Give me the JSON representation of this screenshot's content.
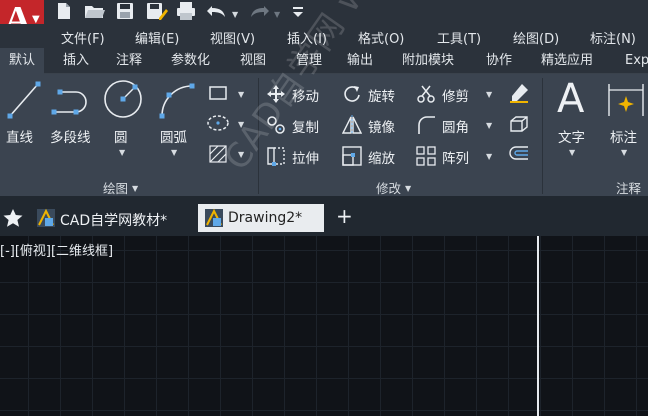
{
  "app": {
    "logo_letter": "A",
    "logo_color": "#c4262a"
  },
  "quick_access": {
    "icons": [
      "new-file-icon",
      "open-folder-icon",
      "save-icon",
      "save-as-icon",
      "print-icon",
      "undo-icon",
      "redo-icon",
      "customize-arrow-icon"
    ]
  },
  "menubar": {
    "items": [
      "文件(F)",
      "编辑(E)",
      "视图(V)",
      "插入(I)",
      "格式(O)",
      "工具(T)",
      "绘图(D)",
      "标注(N)"
    ]
  },
  "ribbon_tabs": {
    "active": "默认",
    "items": [
      "默认",
      "插入",
      "注释",
      "参数化",
      "视图",
      "管理",
      "输出",
      "附加模块",
      "协作",
      "精选应用",
      "Exp"
    ]
  },
  "draw_panel": {
    "title": "绘图",
    "tools": [
      "直线",
      "多段线",
      "圆",
      "圆弧"
    ]
  },
  "modify_panel": {
    "title": "修改",
    "tools": [
      "移动",
      "旋转",
      "修剪",
      "复制",
      "镜像",
      "圆角",
      "拉伸",
      "缩放",
      "阵列"
    ]
  },
  "annotation_panel": {
    "title": "注释",
    "tools": [
      "文字",
      "标注"
    ]
  },
  "file_tabs": {
    "items": [
      "CAD自学网教材*",
      "Drawing2*"
    ],
    "active": "Drawing2*",
    "new_tab": "+"
  },
  "viewport": {
    "label": "[-][俯视][二维线框]"
  },
  "watermark": {
    "text": "CAD自学网 www.cadzxw.com"
  }
}
